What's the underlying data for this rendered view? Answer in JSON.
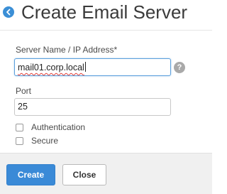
{
  "dialog": {
    "title": "Create Email Server"
  },
  "form": {
    "server": {
      "label": "Server Name / IP Address*",
      "value": "mail01.corp.local"
    },
    "port": {
      "label": "Port",
      "value": "25"
    },
    "authentication": {
      "label": "Authentication",
      "checked": false
    },
    "secure": {
      "label": "Secure",
      "checked": false
    },
    "help_glyph": "?"
  },
  "footer": {
    "create_label": "Create",
    "close_label": "Close"
  },
  "icons": {
    "back": "back-arrow-icon",
    "help": "help-icon"
  },
  "colors": {
    "accent": "#3a8ad7",
    "focus_border": "#5b9fdc",
    "footer_bg": "#f0f0f0"
  }
}
